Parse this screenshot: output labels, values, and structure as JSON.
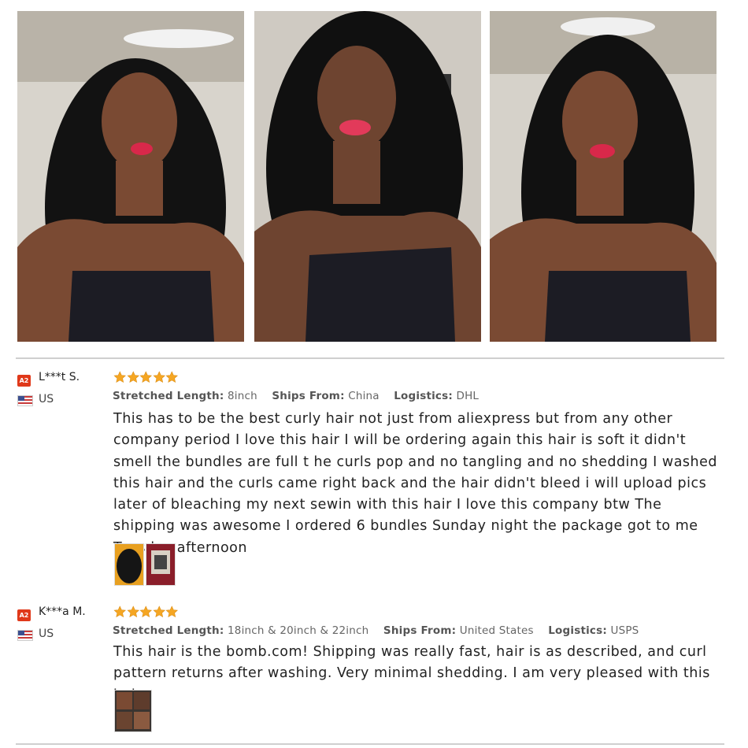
{
  "colors": {
    "star": "#f5a623",
    "badge": "#e0391a",
    "divider": "#cfcfcf"
  },
  "photos": [
    {
      "name": "customer-photo-1"
    },
    {
      "name": "customer-photo-2"
    },
    {
      "name": "customer-photo-3"
    }
  ],
  "reviews": [
    {
      "badge": "A2",
      "reviewer": "L***t S.",
      "country": "US",
      "rating": 5,
      "labels": {
        "length": "Stretched Length:",
        "ships": "Ships From:",
        "logistics": "Logistics:"
      },
      "length": "8inch",
      "ships_from": "China",
      "logistics": "DHL",
      "text": "This has to be the best curly hair not just from aliexpress but from any other company period I love this hair I will be ordering again this hair is soft it didn't smell the bundles are full t he curls pop and no tangling and no shedding I washed this hair and the curls came right back and the hair didn't bleed i will upload pics later of bleaching my next sewin with this hair I love this company btw The shipping was awesome I ordered 6 bundles Sunday night the package got to me Tuesday afternoon",
      "thumbnails": 2
    },
    {
      "badge": "A2",
      "reviewer": "K***a M.",
      "country": "US",
      "rating": 5,
      "labels": {
        "length": "Stretched Length:",
        "ships": "Ships From:",
        "logistics": "Logistics:"
      },
      "length": "18inch & 20inch & 22inch",
      "ships_from": "United States",
      "logistics": "USPS",
      "text": "This hair is the bomb.com! Shipping was really fast, hair is as described, and curl pattern returns after washing. Very minimal shedding. I am very pleased with this hair.",
      "thumbnails": 1
    }
  ]
}
